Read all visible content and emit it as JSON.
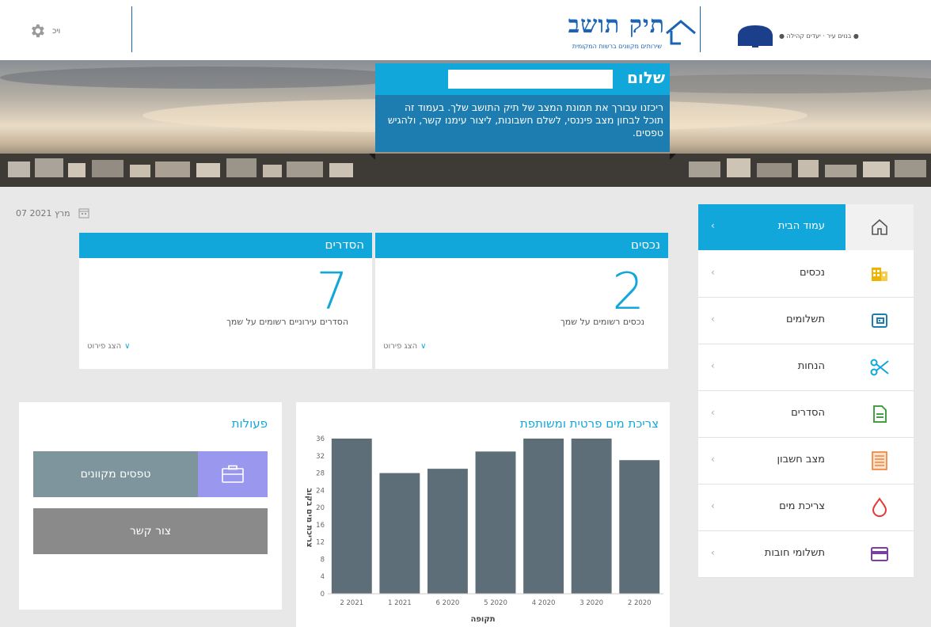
{
  "header": {
    "user_label": "ויכ",
    "logo_title": "תיק תושב",
    "logo_subtitle": "שירותים מקוונים ברשות המקומית",
    "municipality_text": "● בנוים עיר · יעדים קהילה ●"
  },
  "banner": {
    "greeting": "שלום",
    "message": "ריכזנו עבורך את תמונת המצב של תיק התושב שלך. בעמוד זה תוכל לבחון מצב פיננסי, לשלם חשבונות, ליצור עימנו קשר, ולהגיש טפסים."
  },
  "date": "07 מרץ 2021",
  "cards": [
    {
      "title": "נכסים",
      "count": "2",
      "desc": "נכסים רשומים על שמך",
      "more": "הצג פירוט"
    },
    {
      "title": "הסדרים",
      "count": "7",
      "desc": "הסדרים עירוניים רשומים על שמך",
      "more": "הצג פירוט"
    }
  ],
  "actions": {
    "title": "פעולות",
    "forms_button": "טפסים מקוונים",
    "contact_button": "צור קשר"
  },
  "water_chart_title": "צריכת מים פרטית ומשותפת",
  "chart_data": {
    "type": "bar",
    "title": "צריכת מים פרטית ומשותפת",
    "xlabel": "תקופה",
    "ylabel": "צריכת מים בקוב",
    "categories": [
      "2 2021",
      "1 2021",
      "6 2020",
      "5 2020",
      "4 2020",
      "3 2020",
      "2 2020"
    ],
    "values": [
      36,
      28,
      29,
      33,
      36,
      36,
      31
    ],
    "ylim": [
      0,
      36
    ],
    "yticks": [
      0,
      4,
      8,
      12,
      16,
      20,
      24,
      28,
      32,
      36
    ],
    "grid": false,
    "bar_color": "#5e6e78"
  },
  "nav": {
    "items": [
      {
        "label": "עמוד הבית",
        "icon": "home-icon",
        "color": "#555555"
      },
      {
        "label": "נכסים",
        "icon": "building-icon",
        "color": "#f0b400"
      },
      {
        "label": "תשלומים",
        "icon": "wallet-icon",
        "color": "#1e7db0"
      },
      {
        "label": "הנחות",
        "icon": "scissors-icon",
        "color": "#11a7db"
      },
      {
        "label": "הסדרים",
        "icon": "document-icon",
        "color": "#43a047"
      },
      {
        "label": "מצב חשבון",
        "icon": "ledger-icon",
        "color": "#f07e2e"
      },
      {
        "label": "צריכת מים",
        "icon": "water-drop-icon",
        "color": "#e53935"
      },
      {
        "label": "תשלומי חובות",
        "icon": "credit-card-icon",
        "color": "#7b3fa0"
      }
    ]
  },
  "colors": {
    "accent": "#11a7db",
    "brand": "#1b63b5",
    "welcome_body": "#1e7db0"
  }
}
